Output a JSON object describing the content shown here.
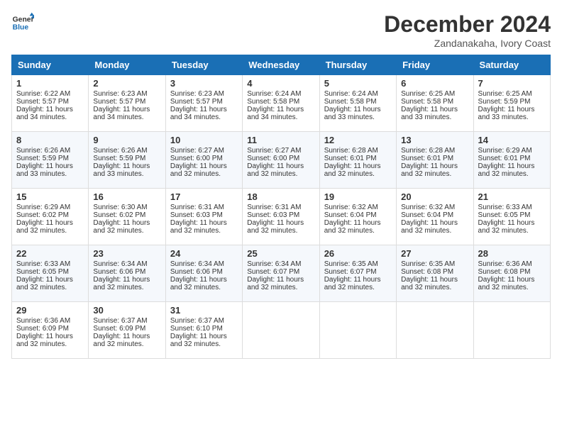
{
  "logo": {
    "text_general": "General",
    "text_blue": "Blue"
  },
  "title": "December 2024",
  "location": "Zandanakaha, Ivory Coast",
  "days_of_week": [
    "Sunday",
    "Monday",
    "Tuesday",
    "Wednesday",
    "Thursday",
    "Friday",
    "Saturday"
  ],
  "weeks": [
    [
      {
        "day": "1",
        "sunrise": "Sunrise: 6:22 AM",
        "sunset": "Sunset: 5:57 PM",
        "daylight": "Daylight: 11 hours and 34 minutes."
      },
      {
        "day": "2",
        "sunrise": "Sunrise: 6:23 AM",
        "sunset": "Sunset: 5:57 PM",
        "daylight": "Daylight: 11 hours and 34 minutes."
      },
      {
        "day": "3",
        "sunrise": "Sunrise: 6:23 AM",
        "sunset": "Sunset: 5:57 PM",
        "daylight": "Daylight: 11 hours and 34 minutes."
      },
      {
        "day": "4",
        "sunrise": "Sunrise: 6:24 AM",
        "sunset": "Sunset: 5:58 PM",
        "daylight": "Daylight: 11 hours and 34 minutes."
      },
      {
        "day": "5",
        "sunrise": "Sunrise: 6:24 AM",
        "sunset": "Sunset: 5:58 PM",
        "daylight": "Daylight: 11 hours and 33 minutes."
      },
      {
        "day": "6",
        "sunrise": "Sunrise: 6:25 AM",
        "sunset": "Sunset: 5:58 PM",
        "daylight": "Daylight: 11 hours and 33 minutes."
      },
      {
        "day": "7",
        "sunrise": "Sunrise: 6:25 AM",
        "sunset": "Sunset: 5:59 PM",
        "daylight": "Daylight: 11 hours and 33 minutes."
      }
    ],
    [
      {
        "day": "8",
        "sunrise": "Sunrise: 6:26 AM",
        "sunset": "Sunset: 5:59 PM",
        "daylight": "Daylight: 11 hours and 33 minutes."
      },
      {
        "day": "9",
        "sunrise": "Sunrise: 6:26 AM",
        "sunset": "Sunset: 5:59 PM",
        "daylight": "Daylight: 11 hours and 33 minutes."
      },
      {
        "day": "10",
        "sunrise": "Sunrise: 6:27 AM",
        "sunset": "Sunset: 6:00 PM",
        "daylight": "Daylight: 11 hours and 32 minutes."
      },
      {
        "day": "11",
        "sunrise": "Sunrise: 6:27 AM",
        "sunset": "Sunset: 6:00 PM",
        "daylight": "Daylight: 11 hours and 32 minutes."
      },
      {
        "day": "12",
        "sunrise": "Sunrise: 6:28 AM",
        "sunset": "Sunset: 6:01 PM",
        "daylight": "Daylight: 11 hours and 32 minutes."
      },
      {
        "day": "13",
        "sunrise": "Sunrise: 6:28 AM",
        "sunset": "Sunset: 6:01 PM",
        "daylight": "Daylight: 11 hours and 32 minutes."
      },
      {
        "day": "14",
        "sunrise": "Sunrise: 6:29 AM",
        "sunset": "Sunset: 6:01 PM",
        "daylight": "Daylight: 11 hours and 32 minutes."
      }
    ],
    [
      {
        "day": "15",
        "sunrise": "Sunrise: 6:29 AM",
        "sunset": "Sunset: 6:02 PM",
        "daylight": "Daylight: 11 hours and 32 minutes."
      },
      {
        "day": "16",
        "sunrise": "Sunrise: 6:30 AM",
        "sunset": "Sunset: 6:02 PM",
        "daylight": "Daylight: 11 hours and 32 minutes."
      },
      {
        "day": "17",
        "sunrise": "Sunrise: 6:31 AM",
        "sunset": "Sunset: 6:03 PM",
        "daylight": "Daylight: 11 hours and 32 minutes."
      },
      {
        "day": "18",
        "sunrise": "Sunrise: 6:31 AM",
        "sunset": "Sunset: 6:03 PM",
        "daylight": "Daylight: 11 hours and 32 minutes."
      },
      {
        "day": "19",
        "sunrise": "Sunrise: 6:32 AM",
        "sunset": "Sunset: 6:04 PM",
        "daylight": "Daylight: 11 hours and 32 minutes."
      },
      {
        "day": "20",
        "sunrise": "Sunrise: 6:32 AM",
        "sunset": "Sunset: 6:04 PM",
        "daylight": "Daylight: 11 hours and 32 minutes."
      },
      {
        "day": "21",
        "sunrise": "Sunrise: 6:33 AM",
        "sunset": "Sunset: 6:05 PM",
        "daylight": "Daylight: 11 hours and 32 minutes."
      }
    ],
    [
      {
        "day": "22",
        "sunrise": "Sunrise: 6:33 AM",
        "sunset": "Sunset: 6:05 PM",
        "daylight": "Daylight: 11 hours and 32 minutes."
      },
      {
        "day": "23",
        "sunrise": "Sunrise: 6:34 AM",
        "sunset": "Sunset: 6:06 PM",
        "daylight": "Daylight: 11 hours and 32 minutes."
      },
      {
        "day": "24",
        "sunrise": "Sunrise: 6:34 AM",
        "sunset": "Sunset: 6:06 PM",
        "daylight": "Daylight: 11 hours and 32 minutes."
      },
      {
        "day": "25",
        "sunrise": "Sunrise: 6:34 AM",
        "sunset": "Sunset: 6:07 PM",
        "daylight": "Daylight: 11 hours and 32 minutes."
      },
      {
        "day": "26",
        "sunrise": "Sunrise: 6:35 AM",
        "sunset": "Sunset: 6:07 PM",
        "daylight": "Daylight: 11 hours and 32 minutes."
      },
      {
        "day": "27",
        "sunrise": "Sunrise: 6:35 AM",
        "sunset": "Sunset: 6:08 PM",
        "daylight": "Daylight: 11 hours and 32 minutes."
      },
      {
        "day": "28",
        "sunrise": "Sunrise: 6:36 AM",
        "sunset": "Sunset: 6:08 PM",
        "daylight": "Daylight: 11 hours and 32 minutes."
      }
    ],
    [
      {
        "day": "29",
        "sunrise": "Sunrise: 6:36 AM",
        "sunset": "Sunset: 6:09 PM",
        "daylight": "Daylight: 11 hours and 32 minutes."
      },
      {
        "day": "30",
        "sunrise": "Sunrise: 6:37 AM",
        "sunset": "Sunset: 6:09 PM",
        "daylight": "Daylight: 11 hours and 32 minutes."
      },
      {
        "day": "31",
        "sunrise": "Sunrise: 6:37 AM",
        "sunset": "Sunset: 6:10 PM",
        "daylight": "Daylight: 11 hours and 32 minutes."
      },
      null,
      null,
      null,
      null
    ]
  ]
}
